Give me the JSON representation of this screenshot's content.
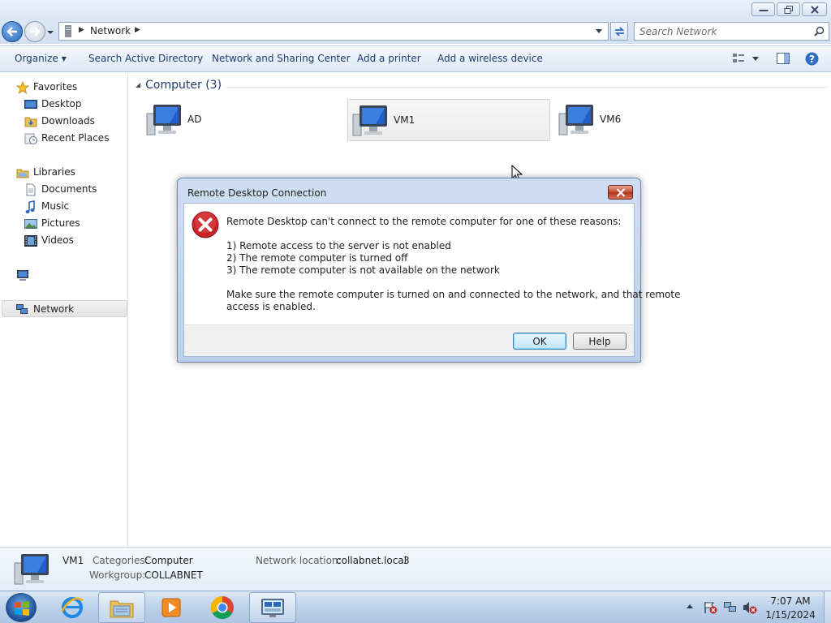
{
  "window": {
    "controls": [
      "minimize",
      "restore",
      "close"
    ]
  },
  "address": {
    "crumb": "Network",
    "search_placeholder": "Search Network"
  },
  "toolbar": {
    "organize": "Organize",
    "search_ad": "Search Active Directory",
    "network_sharing": "Network and Sharing Center",
    "add_printer": "Add a printer",
    "add_wireless": "Add a wireless device"
  },
  "nav": {
    "favorites": "Favorites",
    "desktop": "Desktop",
    "downloads": "Downloads",
    "recent_places": "Recent Places",
    "libraries": "Libraries",
    "documents": "Documents",
    "music": "Music",
    "pictures": "Pictures",
    "videos": "Videos",
    "network": "Network"
  },
  "content": {
    "group_header": "Computer (3)",
    "computers": [
      "AD",
      "VM1",
      "VM6"
    ],
    "selected": "VM1"
  },
  "dialog": {
    "title": "Remote Desktop Connection",
    "line1": "Remote Desktop can't connect to the remote computer for one of these reasons:",
    "reason1": "1) Remote access to the server is not enabled",
    "reason2": "2) The remote computer is turned off",
    "reason3": "3) The remote computer is not available on the network",
    "line5": "Make sure the remote computer is turned on and connected to the network, and that remote",
    "line6": "access is enabled.",
    "ok": "OK",
    "help": "Help"
  },
  "details": {
    "name": "VM1",
    "categories_label": "Categories:",
    "categories_value": "Computer",
    "workgroup_label": "Workgroup:",
    "workgroup_value": "COLLABNET",
    "location_label": "Network location:",
    "location_value": "collabnet.local",
    "location_count": "3"
  },
  "taskbar": {
    "time": "7:07 AM",
    "date": "1/15/2024"
  },
  "colors": {
    "accent": "#2a68b8",
    "link_text": "#1e3d6e",
    "error_red": "#c8242a"
  }
}
